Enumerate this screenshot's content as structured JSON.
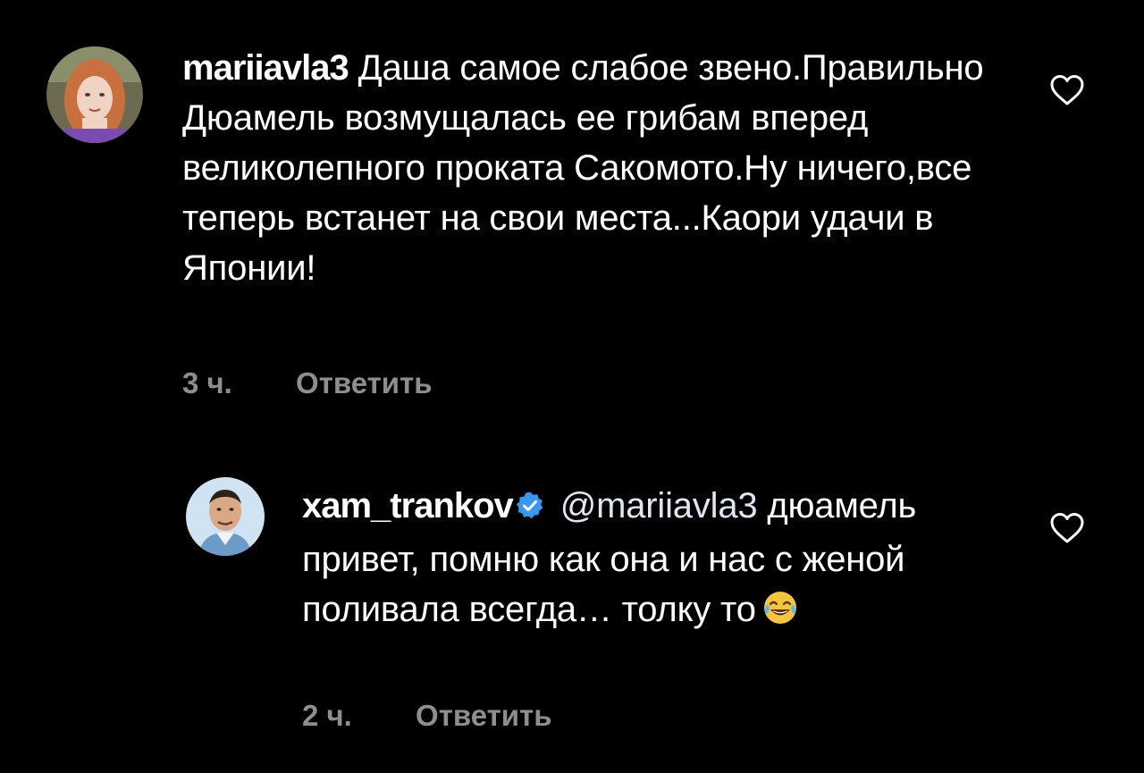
{
  "comments": [
    {
      "username": "mariiavla3",
      "text": "Даша самое слабое звено.Правильно Дюамель возмущалась ее грибам вперед великолепного проката Сакомото.Ну ничего,все теперь встанет на свои места...Каори удачи в Японии!",
      "time": "3 ч.",
      "reply_label": "Ответить",
      "avatar_icon": "user-avatar-red-hair",
      "like_icon": "heart-outline-icon"
    },
    {
      "username": "xam_trankov",
      "verified": true,
      "verified_icon": "verified-badge-icon",
      "mention": "@mariiavla3",
      "text": "дюамель привет, помню как она и нас с женой поливала всегда… толку то",
      "emoji_icon": "tears-of-joy-emoji",
      "time": "2 ч.",
      "reply_label": "Ответить",
      "avatar_icon": "user-avatar-man",
      "like_icon": "heart-outline-icon"
    }
  ],
  "colors": {
    "background": "#000000",
    "text": "#ffffff",
    "meta": "#8e8e8e",
    "verified": "#3897f0"
  }
}
